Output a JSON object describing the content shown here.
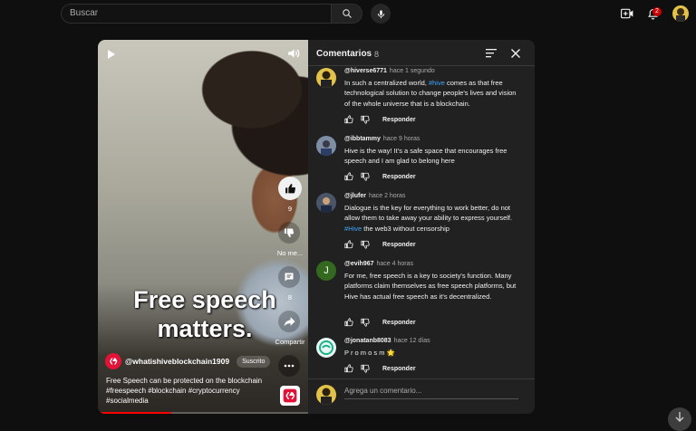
{
  "topbar": {
    "search_placeholder": "Buscar",
    "notification_count": "2"
  },
  "video": {
    "caption_line1": "Free speech",
    "caption_line2": "matters.",
    "channel_name": "@whatishiveblockchain1909",
    "subscribed_label": "Suscrito",
    "description_lines": [
      "Free Speech can be protected on the blockchain",
      "#freespeech #blockchain #cryptocurrency",
      "#socialmedia"
    ],
    "progress_fraction": 0.35
  },
  "actions": {
    "like_count": "9",
    "dislike_label": "No me...",
    "comment_count": "8",
    "share_label": "Compartir"
  },
  "comments_panel": {
    "title": "Comentarios",
    "count": "8",
    "reply_label": "Responder",
    "add_placeholder": "Agrega un comentario...",
    "items": [
      {
        "author": "@hiverse6771",
        "time": "hace 1 segundo",
        "text_parts": [
          "In such a centralized world, ",
          "#hive",
          " comes as that free technological solution to change people's lives and vision of the whole universe that is a blockchain."
        ]
      },
      {
        "author": "@ibbtammy",
        "time": "hace 9 horas",
        "text_parts": [
          "Hive is the way! It's a safe space that encourages free speech and I am glad to belong here"
        ]
      },
      {
        "author": "@jlufer",
        "time": "hace 2 horas",
        "text_parts": [
          "Dialogue is the key for everything to work better, do not allow them to take away your ability to express yourself. ",
          "#Hive",
          " the web3 without censorship"
        ]
      },
      {
        "author": "@evih967",
        "time": "hace 4 horas",
        "avatar_letter": "J",
        "text_parts": [
          "For me, free speech is a key to society's function. Many platforms claim themselves as free speech platforms, but Hive has actual free speech as it's decentralized."
        ]
      },
      {
        "author": "@jonatanb8083",
        "time": "hace 12 días",
        "text_parts": [
          "P r o m o s m 🌟"
        ]
      }
    ]
  },
  "colors": {
    "background": "#0f0f0f",
    "panel": "#212121",
    "hashtag": "#3ea6ff",
    "progress": "#ff0000",
    "badge": "#cc0000"
  }
}
